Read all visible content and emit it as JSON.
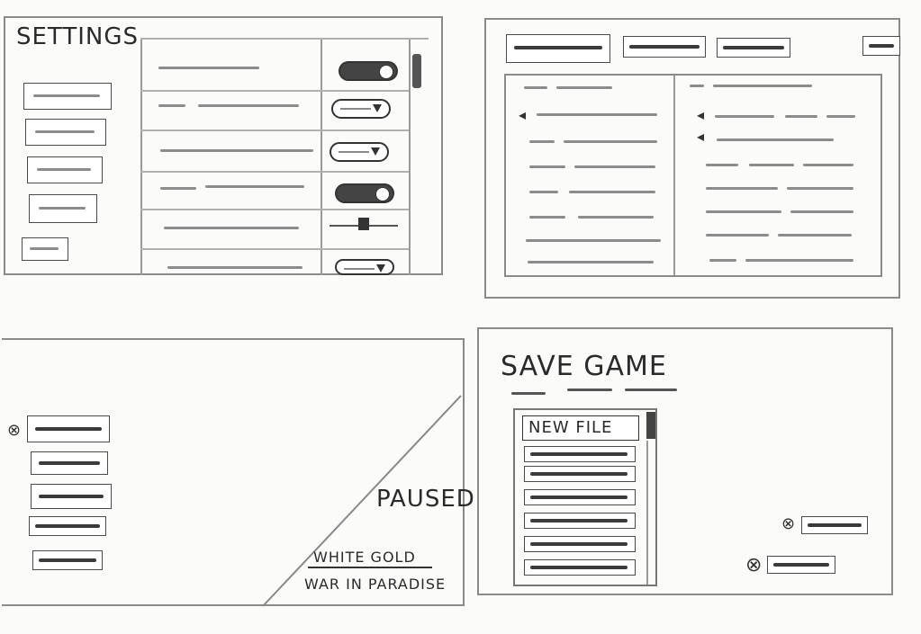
{
  "settings": {
    "title": "SETTINGS",
    "sidebar_items": [
      "",
      "",
      "",
      "",
      ""
    ],
    "rows": [
      {
        "control": "toggle-on"
      },
      {
        "control": "dropdown"
      },
      {
        "control": "dropdown"
      },
      {
        "control": "toggle-on"
      },
      {
        "control": "slider"
      },
      {
        "control": "dropdown"
      }
    ]
  },
  "pause": {
    "title": "PAUSED",
    "subtitle_line1": "WHITE GOLD",
    "subtitle_line2": "WAR IN PARADISE",
    "menu_icon": "x-circle-icon"
  },
  "save": {
    "title": "SAVE GAME",
    "new_file_label": "NEW FILE",
    "slot_count": 7,
    "action_icon_1": "x-circle-icon",
    "action_icon_2": "x-circle-icon"
  }
}
